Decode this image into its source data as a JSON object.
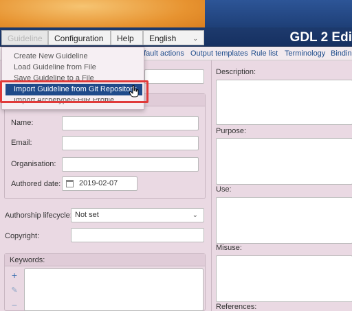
{
  "app_title": "GDL 2 Edi",
  "nav": {
    "guideline_label": "Guideline",
    "configuration_label": "Configuration",
    "help_label": "Help",
    "language_label": "English"
  },
  "tabs": [
    {
      "label": "efault actions"
    },
    {
      "label": "Output templates"
    },
    {
      "label": "Rule list"
    },
    {
      "label": "Terminology"
    },
    {
      "label": "Binding"
    }
  ],
  "menu": {
    "items": [
      {
        "label": "Create New Guideline"
      },
      {
        "label": "Load Guideline from File"
      },
      {
        "label": "Save Guideline to a File"
      },
      {
        "label": "Import Guideline from Git Repository"
      },
      {
        "label": "Import Archetype/FHIR Profile"
      }
    ]
  },
  "author": {
    "name_label": "Name:",
    "email_label": "Email:",
    "organisation_label": "Organisation:",
    "authored_date_label": "Authored date:",
    "authored_date_value": "2019-02-07"
  },
  "authorship": {
    "lifecycle_label": "Authorship lifecycle:",
    "lifecycle_value": "Not set",
    "copyright_label": "Copyright:"
  },
  "keywords": {
    "label": "Keywords:",
    "add_symbol": "+",
    "edit_symbol": "✎",
    "remove_symbol": "−"
  },
  "right": {
    "description_label": "Description:",
    "purpose_label": "Purpose:",
    "use_label": "Use:",
    "misuse_label": "Misuse:",
    "references_label": "References:"
  },
  "colors": {
    "nav_bg": "#1d3a6d",
    "panel_bg": "#ead9e3",
    "selected_item": "#1f4a8a",
    "highlight_border": "#e03a3a"
  }
}
